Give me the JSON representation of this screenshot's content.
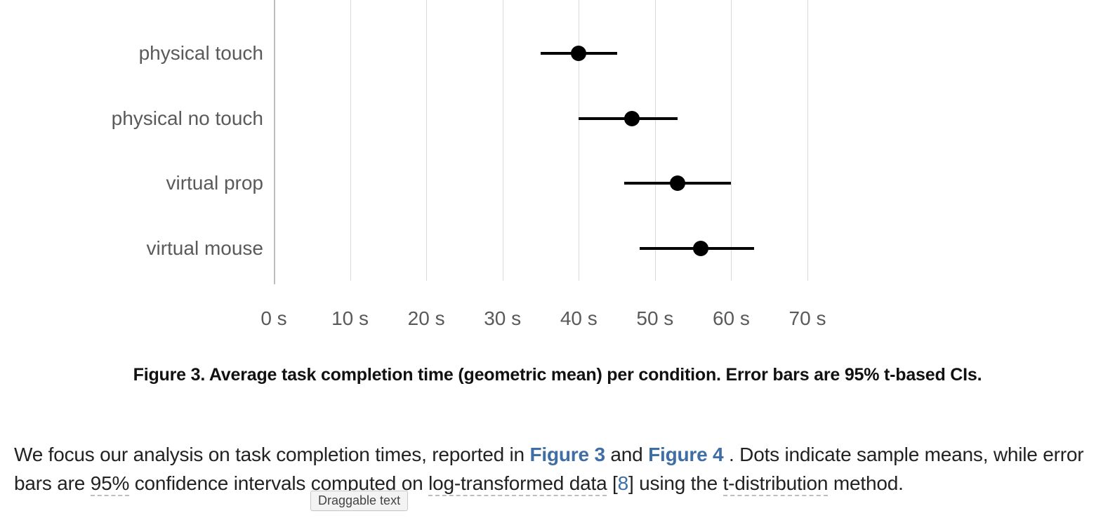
{
  "chart_data": {
    "type": "dot-interval",
    "title": "",
    "xlabel": "",
    "ylabel": "",
    "categories": [
      "physical touch",
      "physical no touch",
      "virtual prop",
      "virtual mouse"
    ],
    "series": [
      {
        "name": "task completion time (s)",
        "points": [
          {
            "category": "physical touch",
            "mean": 40,
            "low": 35,
            "high": 45
          },
          {
            "category": "physical no touch",
            "mean": 47,
            "low": 40,
            "high": 53
          },
          {
            "category": "virtual prop",
            "mean": 53,
            "low": 46,
            "high": 60
          },
          {
            "category": "virtual mouse",
            "mean": 56,
            "low": 48,
            "high": 63
          }
        ]
      }
    ],
    "xticks": [
      0,
      10,
      20,
      30,
      40,
      50,
      60,
      70
    ],
    "xtick_labels": [
      "0 s",
      "10 s",
      "20 s",
      "30 s",
      "40 s",
      "50 s",
      "60 s",
      "70 s"
    ],
    "xlim": [
      0,
      70
    ]
  },
  "caption": "Figure 3. Average task completion time (geometric mean) per condition. Error bars are 95% t-based CIs.",
  "para": {
    "t1": "We focus our analysis on task completion times, reported in ",
    "fig3": "Figure 3",
    "t2": " and ",
    "fig4": "Figure 4",
    "t3": ". Dots indicate sample means, while error bars are ",
    "ci95": "95%",
    "t4": " confidence intervals computed on ",
    "logtrans": "log-transformed data",
    "t5": " [",
    "cite8": "8",
    "t6": "] using the ",
    "tdist": "t-distribution",
    "t7": " method."
  },
  "drag_tag": "Draggable text"
}
